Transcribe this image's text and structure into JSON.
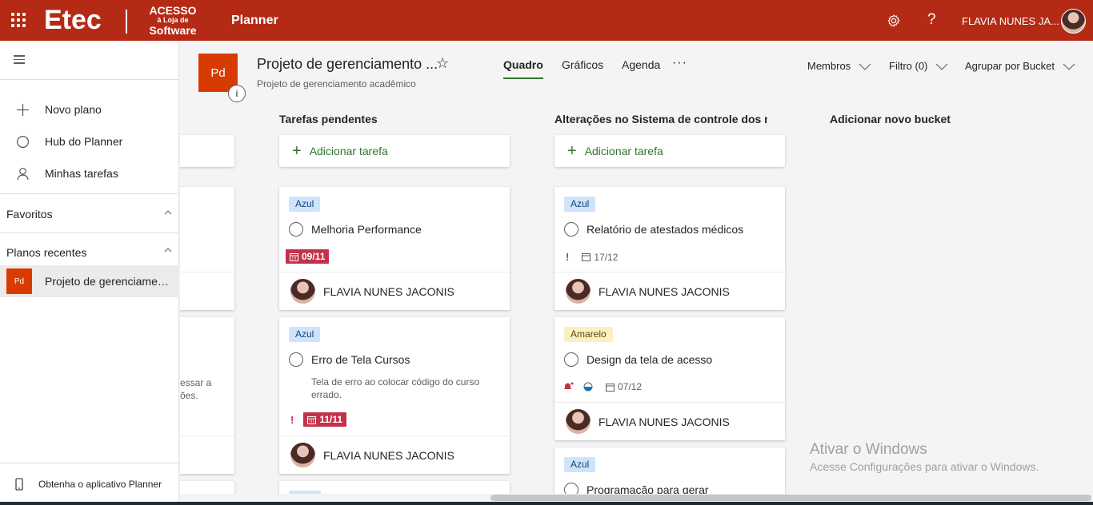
{
  "topbar": {
    "logo_main": "Etec",
    "logo_line1": "ACESSO",
    "logo_line2": "à Loja de",
    "logo_line3": "Software",
    "app_name": "Planner",
    "help": "?",
    "user_name": "FLAVIA NUNES JA..."
  },
  "sidebar": {
    "items": [
      {
        "label": "Novo plano",
        "icon": "plus-icon"
      },
      {
        "label": "Hub do Planner",
        "icon": "circle-icon"
      },
      {
        "label": "Minhas tarefas",
        "icon": "person-icon"
      }
    ],
    "favorites": "Favoritos",
    "recent_title": "Planos recentes",
    "recent_plan_initials": "Pd",
    "recent_plan": "Projeto de gerenciamen...",
    "footer": "Obtenha o aplicativo Planner"
  },
  "plan": {
    "initials": "Pd",
    "info": "i",
    "title": "Projeto de gerenciamento ...",
    "subtitle": "Projeto de gerenciamento acadêmico",
    "star": "☆"
  },
  "tabs": [
    "Quadro",
    "Gráficos",
    "Agenda"
  ],
  "more": "···",
  "header_controls": {
    "members": "Membros",
    "filter": "Filtro (0)",
    "group": "Agrupar por Bucket"
  },
  "buckets": [
    {
      "title": "Tarefas pendentes",
      "add": "Adicionar tarefa",
      "cards": [
        {
          "label": "Azul",
          "title": "Melhoria Performance",
          "date": "09/11",
          "assignee": "FLAVIA NUNES JACONIS"
        },
        {
          "label": "Azul",
          "title": "Erro de Tela Cursos",
          "description": "Tela de erro ao colocar código do curso errado.",
          "urgent": "!",
          "date": "11/11",
          "assignee": "FLAVIA NUNES JACONIS"
        }
      ]
    },
    {
      "title": "Alterações no Sistema de controle dos res",
      "add": "Adicionar tarefa",
      "cards": [
        {
          "label": "Azul",
          "title": "Relatório de atestados médicos",
          "urgent": "!",
          "date": "17/12",
          "assignee": "FLAVIA NUNES JACONIS"
        },
        {
          "label": "Amarelo",
          "title": "Design da tela de acesso",
          "date": "07/12",
          "assignee": "FLAVIA NUNES JACONIS"
        },
        {
          "label": "Azul",
          "title": "Programação para gerar"
        }
      ]
    }
  ],
  "new_bucket": "Adicionar novo bucket",
  "partial_left": {
    "text1": "essar a",
    "text2": "ões."
  },
  "watermark": {
    "line1": "Ativar o Windows",
    "line2": "Acesse Configurações para ativar o Windows."
  },
  "colors": {
    "brand": "#b52a15",
    "plan": "#d83b01",
    "accent": "#31752f",
    "late": "#c4314b"
  }
}
